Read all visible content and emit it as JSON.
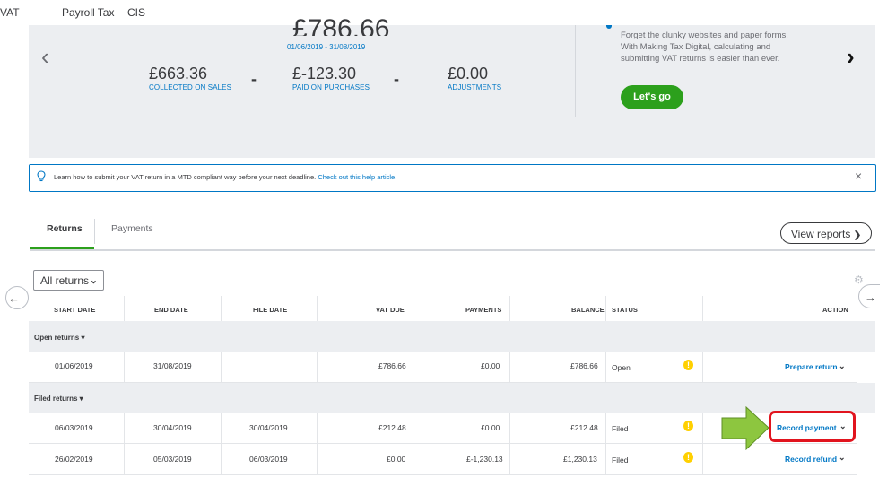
{
  "top_nav": {
    "vat": "VAT",
    "payroll_tax": "Payroll Tax",
    "cis": "CIS"
  },
  "summary": {
    "total": "£786.66",
    "period": "01/06/2019 - 31/08/2019",
    "collected_amount": "£663.36",
    "collected_label": "COLLECTED ON SALES",
    "paid_amount": "£-123.30",
    "paid_label": "PAID ON PURCHASES",
    "adjustments_amount": "£0.00",
    "adjustments_label": "ADJUSTMENTS",
    "operator_minus": "-",
    "prev_arrow": "‹",
    "next_arrow": "›"
  },
  "promo": {
    "line1": "Forget the clunky websites and paper forms.",
    "line2": "With Making Tax Digital, calculating and",
    "line3": "submitting VAT returns is easier than ever.",
    "button": "Let's go"
  },
  "banner": {
    "text": "Learn how to submit your VAT return in a MTD compliant way before your next deadline.",
    "link": "Check out this help article.",
    "close": "×"
  },
  "tabs": [
    {
      "label": "Returns"
    },
    {
      "label": "Payments"
    }
  ],
  "view_reports": "View reports",
  "filter": {
    "selected": "All returns"
  },
  "table": {
    "headers": [
      "START DATE",
      "END DATE",
      "FILE DATE",
      "VAT DUE",
      "PAYMENTS",
      "BALANCE",
      "STATUS",
      "ACTION"
    ],
    "groups": [
      {
        "label": "Open returns ▾",
        "rows": [
          {
            "start": "01/06/2019",
            "end": "31/08/2019",
            "file": "",
            "vat_due": "£786.66",
            "payments": "£0.00",
            "balance": "£786.66",
            "status": "Open",
            "action": "Prepare return"
          }
        ]
      },
      {
        "label": "Filed returns ▾",
        "rows": [
          {
            "start": "06/03/2019",
            "end": "30/04/2019",
            "file": "30/04/2019",
            "vat_due": "£212.48",
            "payments": "£0.00",
            "balance": "£212.48",
            "status": "Filed",
            "action": "Record payment"
          },
          {
            "start": "26/02/2019",
            "end": "05/03/2019",
            "file": "06/03/2019",
            "vat_due": "£0.00",
            "payments": "£-1,230.13",
            "balance": "£1,230.13",
            "status": "Filed",
            "action": "Record refund"
          }
        ]
      }
    ]
  },
  "icons": {
    "warning": "!",
    "chevron_down": "▾",
    "left_arrow": "←",
    "right_arrow": "→",
    "info": "lightbulb-icon",
    "gear": "gear-icon"
  },
  "colors": {
    "accent_green": "#2ca01c",
    "link_blue": "#0077c5",
    "highlight_red": "#e1141e",
    "warning_yellow": "#ffd000",
    "callout_arrow_green": "#8dc63f"
  }
}
